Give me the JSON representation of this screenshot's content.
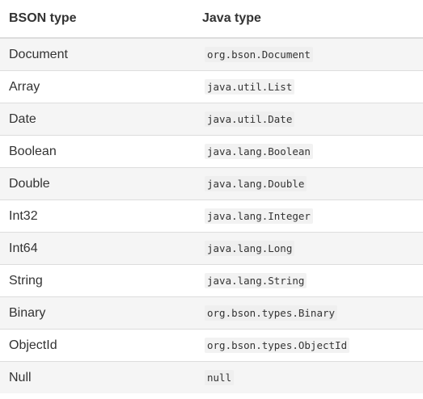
{
  "table": {
    "headers": {
      "bson": "BSON type",
      "java": "Java type"
    },
    "rows": [
      {
        "bson": "Document",
        "java": "org.bson.Document"
      },
      {
        "bson": "Array",
        "java": "java.util.List"
      },
      {
        "bson": "Date",
        "java": "java.util.Date"
      },
      {
        "bson": "Boolean",
        "java": "java.lang.Boolean"
      },
      {
        "bson": "Double",
        "java": "java.lang.Double"
      },
      {
        "bson": "Int32",
        "java": "java.lang.Integer"
      },
      {
        "bson": "Int64",
        "java": "java.lang.Long"
      },
      {
        "bson": "String",
        "java": "java.lang.String"
      },
      {
        "bson": "Binary",
        "java": "org.bson.types.Binary"
      },
      {
        "bson": "ObjectId",
        "java": "org.bson.types.ObjectId"
      },
      {
        "bson": "Null",
        "java": "null"
      }
    ]
  }
}
